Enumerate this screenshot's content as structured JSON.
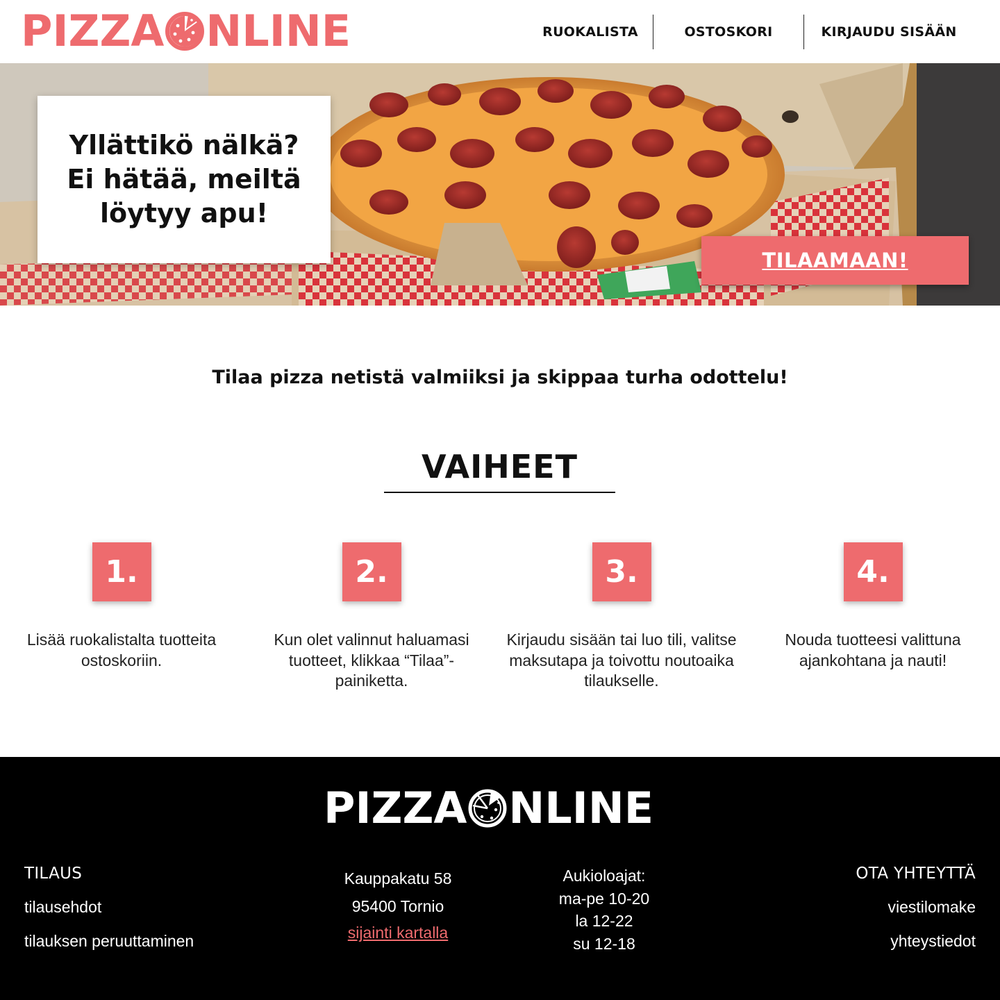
{
  "brand": {
    "logo_left": "PIZZA",
    "logo_right": "NLINE",
    "accent_color": "#ee6b6e"
  },
  "nav": {
    "items": [
      {
        "label": "RUOKALISTA"
      },
      {
        "label": "OSTOSKORI"
      },
      {
        "label": "KIRJAUDU SISÄÄN"
      }
    ]
  },
  "hero": {
    "heading": "Yllättikö nälkä? Ei hätää, meiltä löytyy apu!",
    "cta_label": "TILAAMAAN!"
  },
  "tagline": "Tilaa pizza netistä valmiiksi ja skippaa turha odottelu!",
  "steps": {
    "title": "VAIHEET",
    "items": [
      {
        "number": "1.",
        "text": "Lisää ruokalistalta tuotteita ostoskoriin."
      },
      {
        "number": "2.",
        "text": "Kun olet valinnut haluamasi tuotteet, klikkaa “Tilaa”-painiketta."
      },
      {
        "number": "3.",
        "text": "Kirjaudu sisään tai luo tili, valitse maksutapa ja toivottu noutoaika tilaukselle."
      },
      {
        "number": "4.",
        "text": "Nouda tuotteesi valittuna ajankohtana ja nauti!"
      }
    ]
  },
  "footer": {
    "order": {
      "heading": "TILAUS",
      "links": [
        "tilausehdot",
        "tilauksen peruuttaminen"
      ]
    },
    "address": {
      "street": "Kauppakatu 58",
      "city": "95400 Tornio",
      "map_link": "sijainti kartalla"
    },
    "hours": {
      "heading": "Aukioloajat:",
      "lines": [
        "ma-pe 10-20",
        "la 12-22",
        "su 12-18"
      ]
    },
    "contact": {
      "heading": "OTA YHTEYTTÄ",
      "links": [
        "viestilomake",
        "yhteystiedot"
      ]
    }
  }
}
